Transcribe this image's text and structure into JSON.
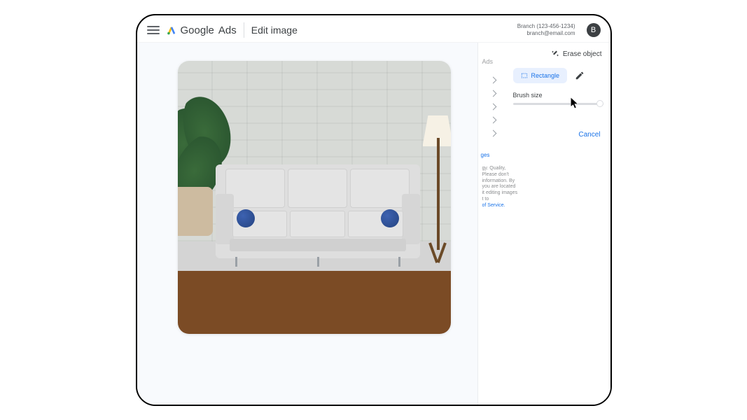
{
  "brand": {
    "word1": "Google",
    "word2": "Ads"
  },
  "page_title": "Edit image",
  "account": {
    "name": "Branch (123-456-1234)",
    "email": "branch@email.com",
    "avatar_letter": "B"
  },
  "panel": {
    "peek_label": "Ads",
    "title": "Erase object",
    "rectangle_label": "Rectangle",
    "brush_label": "Brush size",
    "cancel": "Cancel",
    "ges_hint": "ges",
    "fine_print_lines": [
      "gy. Quality,",
      "Please don't",
      "information. By",
      "you are located",
      "it editing images",
      "t to"
    ],
    "fine_print_link": "of Service."
  }
}
